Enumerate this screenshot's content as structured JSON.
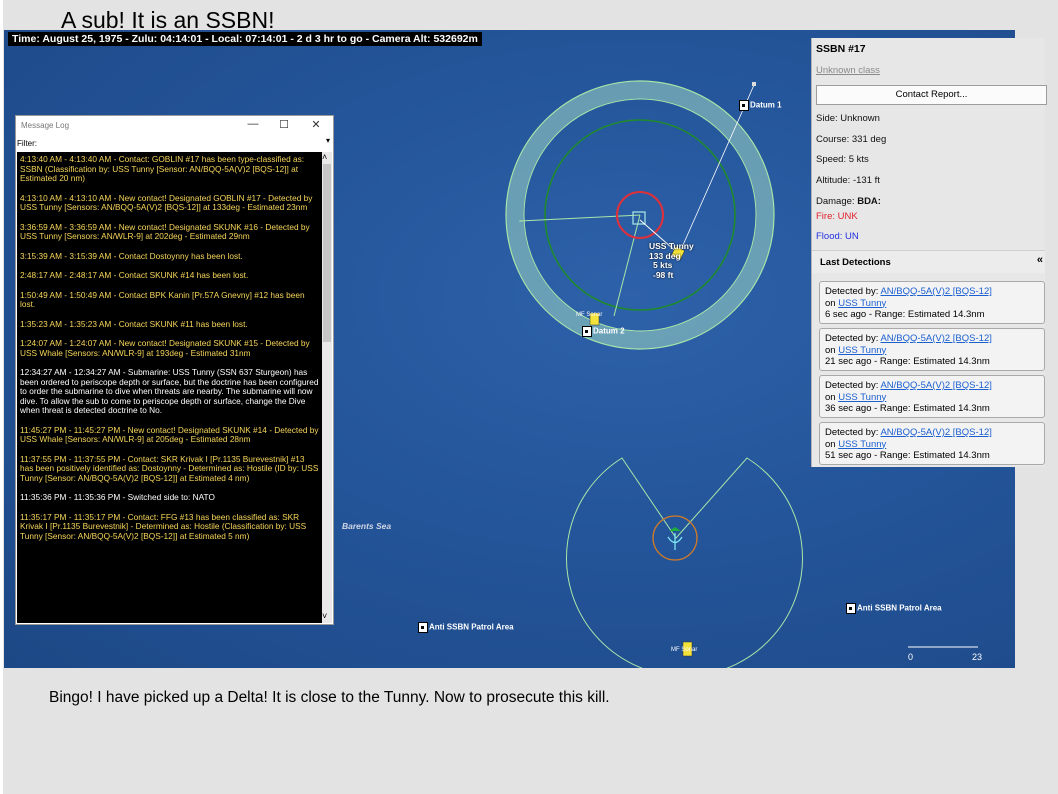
{
  "slide": {
    "title": "A sub!  It is an SSBN!",
    "caption": "Bingo!  I have picked up a Delta!  It is close to the Tunny.  Now to prosecute this kill."
  },
  "game": {
    "timebar": "Time: August 25, 1975 - Zulu: 04:14:01 - Local: 07:14:01 - 2 d 3 hr to go -  Camera Alt: 532692m",
    "sea_label": "Barents Sea",
    "datum1": "Datum 1",
    "datum2": "Datum 2",
    "patrol_area_1": "Anti SSBN Patrol Area",
    "patrol_area_2": "Anti SSBN Patrol Area",
    "mf_label_1": "MF Sonar",
    "mf_label_2": "MF Sonar",
    "unit": {
      "name": "USS Tunny",
      "heading": "133 deg",
      "speed": "5 kts",
      "depth": "-98 ft"
    },
    "scale": {
      "start": "0",
      "end": "23"
    },
    "colors": {
      "sea": "#24559a",
      "sonar_ring": "#9fe0a5",
      "contact_ring": "#e0303a",
      "range_ring": "#1f8a2e"
    }
  },
  "message_log": {
    "title": "Message Log",
    "minimize": "—",
    "maximize": "☐",
    "close": "✕",
    "filter_label": "Filter:",
    "messages": [
      {
        "text": "4:13:40 AM - 4:13:40 AM - Contact: GOBLIN #17 has been type-classified as: SSBN (Classification by: USS Tunny [Sensor: AN/BQQ-5A(V)2 [BQS-12]] at Estimated 20 nm)",
        "color": "y"
      },
      {
        "text": "4:13:10 AM - 4:13:10 AM - New contact! Designated GOBLIN #17 - Detected by USS Tunny [Sensors: AN/BQQ-5A(V)2 [BQS-12]] at 133deg - Estimated 23nm",
        "color": "y"
      },
      {
        "text": "3:36:59 AM - 3:36:59 AM - New contact! Designated SKUNK #16 - Detected by USS Tunny [Sensors: AN/WLR-9] at 202deg - Estimated 29nm",
        "color": "y"
      },
      {
        "text": "3:15:39 AM - 3:15:39 AM - Contact Dostoynny has been lost.",
        "color": "y"
      },
      {
        "text": "2:48:17 AM - 2:48:17 AM - Contact SKUNK #14 has been lost.",
        "color": "y"
      },
      {
        "text": "1:50:49 AM - 1:50:49 AM - Contact BPK Kanin [Pr.57A Gnevny] #12 has been lost.",
        "color": "y"
      },
      {
        "text": "1:35:23 AM - 1:35:23 AM - Contact SKUNK #11 has been lost.",
        "color": "y"
      },
      {
        "text": "1:24:07 AM - 1:24:07 AM - New contact! Designated SKUNK #15 - Detected by USS Whale [Sensors: AN/WLR-9] at 193deg - Estimated 31nm",
        "color": "y"
      },
      {
        "text": "12:34:27 AM - 12:34:27 AM - Submarine: USS Tunny (SSN 637 Sturgeon) has been ordered to periscope depth or surface, but the doctrine has been configured to order the submarine to dive when threats are nearby. The submarine will now dive. To allow the sub to come to periscope depth or surface, change the Dive when threat is detected doctrine to No.",
        "color": "w"
      },
      {
        "text": "11:45:27 PM - 11:45:27 PM - New contact! Designated SKUNK #14 - Detected by USS Whale [Sensors: AN/WLR-9] at 205deg - Estimated 28nm",
        "color": "y"
      },
      {
        "text": "11:37:55 PM - 11:37:55 PM - Contact: SKR Krivak I [Pr.1135 Burevestnik] #13 has been positively identified as: Dostoynny - Determined as: Hostile (ID by: USS Tunny [Sensor: AN/BQQ-5A(V)2 [BQS-12]] at Estimated 4 nm)",
        "color": "y"
      },
      {
        "text": "11:35:36 PM - 11:35:36 PM - Switched side to: NATO",
        "color": "w"
      },
      {
        "text": "11:35:17 PM - 11:35:17 PM - Contact: FFG #13 has been classified as: SKR Krivak I [Pr.1135 Burevestnik] - Determined as: Hostile (Classification by: USS Tunny [Sensor: AN/BQQ-5A(V)2 [BQS-12]] at Estimated 5 nm)",
        "color": "y"
      }
    ]
  },
  "contact_panel": {
    "title": "SSBN #17",
    "class_link": "Unknown class",
    "report_button": "Contact Report...",
    "side": "Side: Unknown",
    "course": "Course: 331 deg",
    "speed": "Speed: 5 kts",
    "altitude": "Altitude: -131 ft",
    "damage_label": "Damage:",
    "damage_value": "BDA:",
    "fire": "Fire: UNK",
    "flood": "Flood: UN",
    "last_detections_label": "Last Detections",
    "collapse_icon": "«",
    "detections": [
      {
        "by_label": "Detected by:",
        "sensor": "AN/BQQ-5A(V)2 [BQS-12]",
        "on_label": "on",
        "unit": "USS Tunny",
        "time": "6 sec ago - Range: Estimated 14.3nm"
      },
      {
        "by_label": "Detected by:",
        "sensor": "AN/BQQ-5A(V)2 [BQS-12]",
        "on_label": "on",
        "unit": "USS Tunny",
        "time": "21 sec ago - Range: Estimated 14.3nm"
      },
      {
        "by_label": "Detected by:",
        "sensor": "AN/BQQ-5A(V)2 [BQS-12]",
        "on_label": "on",
        "unit": "USS Tunny",
        "time": "36 sec ago - Range: Estimated 14.3nm"
      },
      {
        "by_label": "Detected by:",
        "sensor": "AN/BQQ-5A(V)2 [BQS-12]",
        "on_label": "on",
        "unit": "USS Tunny",
        "time": "51 sec ago - Range: Estimated 14.3nm"
      }
    ]
  }
}
